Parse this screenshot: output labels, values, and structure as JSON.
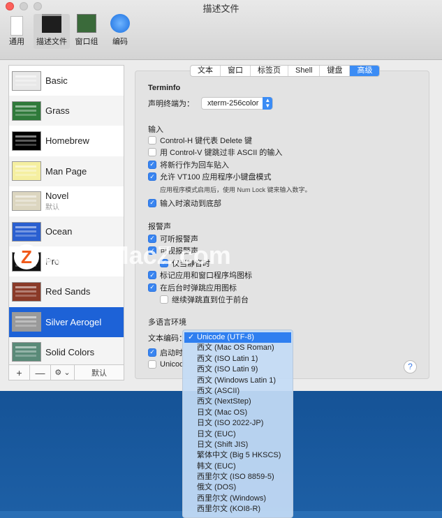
{
  "window": {
    "title": "描述文件"
  },
  "toolbar": [
    {
      "label": "通用",
      "icon": "switch-icon"
    },
    {
      "label": "描述文件",
      "icon": "terminal-icon",
      "selected": true
    },
    {
      "label": "窗口组",
      "icon": "window-groups-icon"
    },
    {
      "label": "编码",
      "icon": "globe-icon"
    }
  ],
  "profiles": [
    {
      "name": "Basic",
      "color": "#e8e8e8"
    },
    {
      "name": "Grass",
      "color": "#2f7a3a"
    },
    {
      "name": "Homebrew",
      "color": "#000000"
    },
    {
      "name": "Man Page",
      "color": "#f5efa0"
    },
    {
      "name": "Novel",
      "sub": "默认",
      "color": "#dcd6c0"
    },
    {
      "name": "Ocean",
      "color": "#2a5fd0"
    },
    {
      "name": "Pro",
      "color": "#111111"
    },
    {
      "name": "Red Sands",
      "color": "#8a3a28"
    },
    {
      "name": "Silver Aerogel",
      "color": "#9a9a9a",
      "selected": true
    },
    {
      "name": "Solid Colors",
      "color": "#5a8a78"
    }
  ],
  "list_bar": {
    "add": "+",
    "remove": "—",
    "gear": "⚙ ⌄",
    "default": "默认"
  },
  "tabs": [
    {
      "label": "文本"
    },
    {
      "label": "窗口"
    },
    {
      "label": "标签页"
    },
    {
      "label": "Shell"
    },
    {
      "label": "键盘"
    },
    {
      "label": "高级",
      "selected": true
    }
  ],
  "terminfo": {
    "heading": "Terminfo",
    "label": "声明终端为：",
    "value": "xterm-256color"
  },
  "input": {
    "heading": "输入",
    "items": [
      {
        "label": "Control-H 键代表 Delete 键",
        "checked": false
      },
      {
        "label": "用 Control-V 键跳过非 ASCII 的输入",
        "checked": false
      },
      {
        "label": "将新行作为回车贴入",
        "checked": true
      },
      {
        "label": "允许 VT100 应用程序小键盘模式",
        "checked": true
      }
    ],
    "note": "应用程序模式启用后，使用 Num Lock 键来输入数字。",
    "scroll": {
      "label": "输入时滚动到底部",
      "checked": true
    }
  },
  "bell": {
    "heading": "报警声",
    "items": [
      {
        "label": "可听报警声",
        "checked": true
      },
      {
        "label": "可视报警声",
        "checked": true
      },
      {
        "label": "仅当静音时",
        "checked": true,
        "indent": true
      },
      {
        "label": "标记应用和窗口程序坞图标",
        "checked": true
      },
      {
        "label": "在后台时弹跳应用图标",
        "checked": true
      },
      {
        "label": "继续弹跳直到位于前台",
        "checked": false,
        "indent": true
      }
    ]
  },
  "locale": {
    "heading": "多语言环境",
    "encoding_label": "文本编码：",
    "startup": {
      "label": "启动时",
      "checked": true
    },
    "unicode": {
      "label": "Unicod",
      "checked": false
    }
  },
  "encoding_menu": [
    "Unicode (UTF-8)",
    "西文 (Mac OS Roman)",
    "西文 (ISO Latin 1)",
    "西文 (ISO Latin 9)",
    "西文 (Windows Latin 1)",
    "西文 (ASCII)",
    "西文 (NextStep)",
    "日文 (Mac OS)",
    "日文 (ISO 2022-JP)",
    "日文 (EUC)",
    "日文 (Shift JIS)",
    "繁体中文 (Big 5 HKSCS)",
    "韩文 (EUC)",
    "西里尔文 (ISO 8859-5)",
    "俄文 (DOS)",
    "西里尔文 (Windows)",
    "西里尔文 (KOI8-R)"
  ],
  "encoding_selected": "Unicode (UTF-8)",
  "help": "?",
  "watermark": "www.MacZ.com",
  "colors": {
    "accent": "#3b8cf5",
    "selection": "#1d62d7"
  }
}
